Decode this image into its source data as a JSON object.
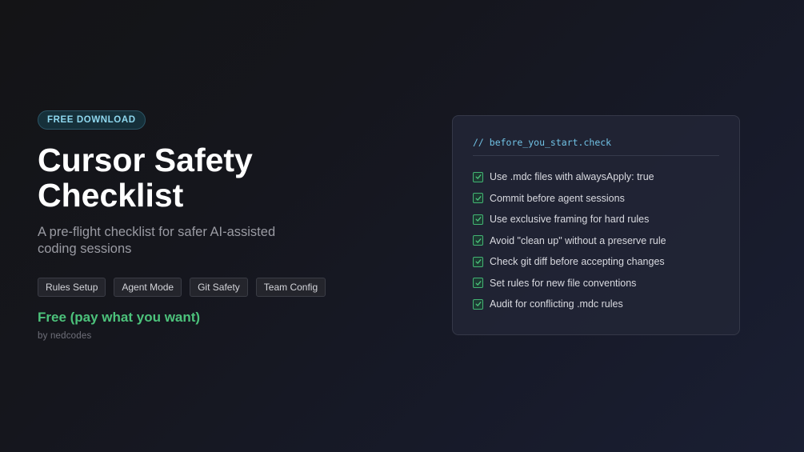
{
  "hero": {
    "badge": "FREE DOWNLOAD",
    "title": "Cursor Safety Checklist",
    "subtitle": "A pre-flight checklist for safer AI-assisted coding sessions",
    "tags": [
      "Rules Setup",
      "Agent Mode",
      "Git Safety",
      "Team Config"
    ],
    "price": "Free (pay what you want)",
    "author": "by nedcodes"
  },
  "card": {
    "comment": "// before_you_start.check",
    "items": [
      "Use .mdc files with alwaysApply: true",
      "Commit before agent sessions",
      "Use exclusive framing for hard rules",
      "Avoid \"clean up\" without a preserve rule",
      "Check git diff before accepting changes",
      "Set rules for new file conventions",
      "Audit for conflicting .mdc rules"
    ],
    "check_icon": "check-icon"
  },
  "colors": {
    "accent_green": "#4cc27b",
    "badge_text": "#8fd8ef",
    "code_comment": "#71c3e6"
  }
}
